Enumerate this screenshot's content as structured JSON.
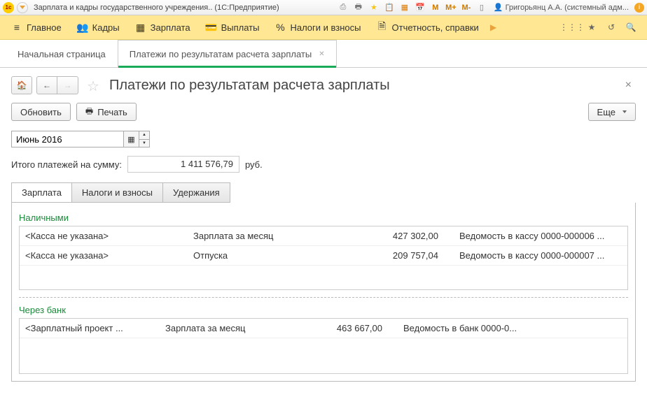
{
  "titlebar": {
    "title": "Зарплата и кадры государственного учреждения.. (1С:Предприятие)",
    "m1": "М",
    "m2": "М+",
    "m3": "М-",
    "user": "Григорьянц А.А. (системный адм..."
  },
  "maintb": {
    "main": "Главное",
    "personnel": "Кадры",
    "salary": "Зарплата",
    "payments": "Выплаты",
    "taxes": "Налоги и взносы",
    "reports": "Отчетность, справки"
  },
  "tabs": {
    "start": "Начальная страница",
    "payments": "Платежи по результатам расчета зарплаты"
  },
  "page": {
    "title": "Платежи по результатам расчета зарплаты",
    "refresh": "Обновить",
    "print": "Печать",
    "more": "Еще",
    "period": "Июнь 2016",
    "total_label": "Итого платежей на сумму:",
    "total_value": "1 411 576,79",
    "currency": "руб."
  },
  "subtabs": {
    "salary": "Зарплата",
    "taxes": "Налоги и взносы",
    "deductions": "Удержания"
  },
  "sections": {
    "cash": "Наличными",
    "bank": "Через банк"
  },
  "cash_rows": [
    {
      "c1": "<Касса не указана>",
      "c2": "Зарплата за месяц",
      "c3": "427 302,00",
      "c4": "Ведомость в кассу 0000-000006 ..."
    },
    {
      "c1": "<Касса не указана>",
      "c2": "Отпуска",
      "c3": "209 757,04",
      "c4": "Ведомость в кассу 0000-000007 ..."
    }
  ],
  "bank_rows": [
    {
      "c1": "<Зарплатный проект ...",
      "c2": "Зарплата за месяц",
      "c3": "463 667,00",
      "c4": "Ведомость в банк 0000-0..."
    }
  ]
}
